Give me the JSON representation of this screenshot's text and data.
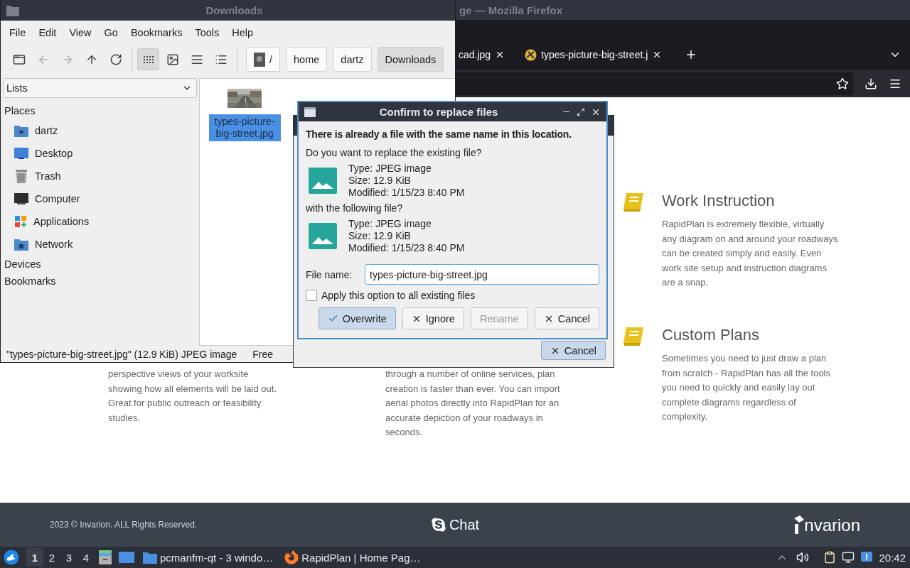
{
  "file_manager": {
    "title": "Downloads",
    "menu": [
      "File",
      "Edit",
      "View",
      "Go",
      "Bookmarks",
      "Tools",
      "Help"
    ],
    "nav": [
      {
        "kind": "new-window",
        "disabled": false
      },
      {
        "kind": "back",
        "disabled": true
      },
      {
        "kind": "forward",
        "disabled": true
      },
      {
        "kind": "up",
        "disabled": false
      },
      {
        "kind": "reload",
        "disabled": false
      }
    ],
    "view_modes": [
      {
        "kind": "icons",
        "selected": true
      },
      {
        "kind": "thumbnails",
        "selected": false
      },
      {
        "kind": "compact",
        "selected": false
      },
      {
        "kind": "details",
        "selected": false
      }
    ],
    "path": [
      {
        "label": "/",
        "kind": "root",
        "selected": false
      },
      {
        "label": "home",
        "kind": "folder",
        "selected": false
      },
      {
        "label": "dartz",
        "kind": "folder",
        "selected": false
      },
      {
        "label": "Downloads",
        "kind": "folder",
        "selected": true
      }
    ],
    "side_view": "Lists",
    "sections": [
      {
        "label": "Places",
        "children": [
          {
            "label": "dartz",
            "kind": "home"
          },
          {
            "label": "Desktop",
            "kind": "desktop"
          },
          {
            "label": "Trash",
            "kind": "trash"
          },
          {
            "label": "Computer",
            "kind": "computer"
          },
          {
            "label": "Applications",
            "kind": "applications"
          },
          {
            "label": "Network",
            "kind": "network"
          }
        ]
      },
      {
        "label": "Devices"
      },
      {
        "label": "Bookmarks"
      }
    ],
    "files": [
      {
        "name": "types-picture-big-street.jpg",
        "selected": true
      }
    ],
    "status": "\"types-picture-big-street.jpg\" (12.9 KiB) JPEG image",
    "status_free": "Free"
  },
  "browser": {
    "title": "ge — Mozilla Firefox",
    "tabs": [
      {
        "label": "cad.jpg"
      },
      {
        "label": "types-picture-big-street.j"
      }
    ],
    "features": [
      {
        "title": "Work Instruction",
        "body": "RapidPlan is extremely flexible, virtually any diagram on and around your roadways can be created simply and easily. Even work site setup and instruction diagrams are a snap."
      },
      {
        "body": "perspective views of your worksite showing how all elements will be laid out. Great for public outreach or feasibility studies."
      },
      {
        "body": "through a number of online services, plan creation is faster than ever. You can import aerial photos directly into RapidPlan for an accurate depiction of your roadways in seconds."
      },
      {
        "title": "Custom Plans",
        "body": "Sometimes you need to just draw a plan from scratch - RapidPlan has all the tools you need to quickly and easily lay out complete diagrams regardless of complexity."
      }
    ],
    "footer": {
      "copyright": "2023 © Invarion. ALL Rights Reserved.",
      "chat": "Chat",
      "logo": "nvarion"
    }
  },
  "back_dialog": {
    "buttons": [
      {
        "label": "Cancel",
        "kind": "cross",
        "default": true,
        "disabled": false
      }
    ]
  },
  "dialog": {
    "title": "Confirm to replace files",
    "heading": "There is already a file with the same name in this location.",
    "question": "Do you want to replace the existing file?",
    "existing": [
      "Type: JPEG image",
      "Size: 12.9 KiB",
      "Modified: 1/15/23 8:40 PM"
    ],
    "with_label": "with the following file?",
    "incoming": [
      "Type: JPEG image",
      "Size: 12.9 KiB",
      "Modified: 1/15/23 8:40 PM"
    ],
    "file_name_label": "File name:",
    "file_name": "types-picture-big-street.jpg",
    "apply_all": {
      "label": "Apply this option to all existing files",
      "checked": false
    },
    "buttons": [
      {
        "label": "Overwrite",
        "kind": "check",
        "default": true,
        "disabled": false
      },
      {
        "label": "Ignore",
        "kind": "cross",
        "default": false,
        "disabled": false
      },
      {
        "label": "Rename",
        "kind": "none",
        "default": false,
        "disabled": true
      },
      {
        "label": "Cancel",
        "kind": "cross",
        "default": false,
        "disabled": false
      }
    ]
  },
  "taskbar": {
    "desktops": [
      {
        "label": "1",
        "selected": true
      },
      {
        "label": "2",
        "selected": false
      },
      {
        "label": "3",
        "selected": false
      },
      {
        "label": "4",
        "selected": false
      }
    ],
    "tasks": [
      {
        "label": "pcmanfm-qt - 3 windo…",
        "kind": "folder"
      },
      {
        "label": "RapidPlan | Home Pag…",
        "kind": "firefox"
      }
    ],
    "clock": "20:42"
  }
}
